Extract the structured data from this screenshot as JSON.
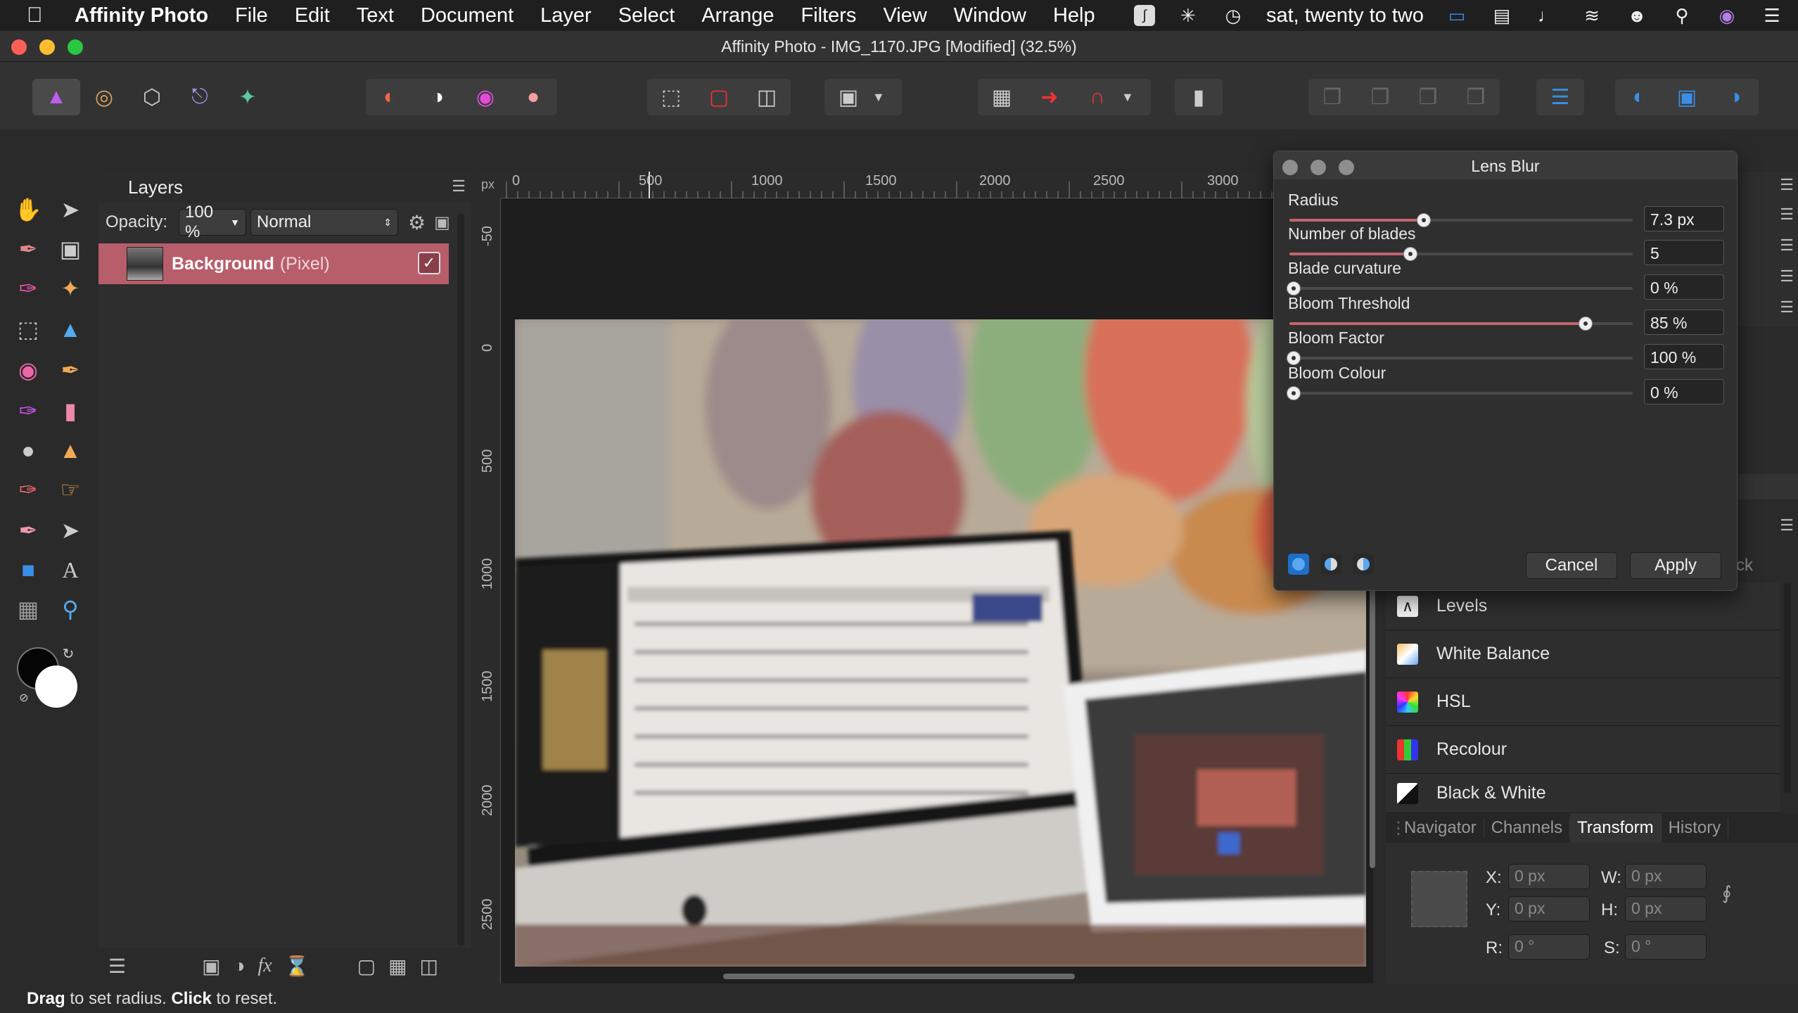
{
  "menubar": {
    "app_name": "Affinity Photo",
    "items": [
      "File",
      "Edit",
      "Text",
      "Document",
      "Layer",
      "Select",
      "Arrange",
      "Filters",
      "View",
      "Window",
      "Help"
    ],
    "clock": "sat, twenty to two"
  },
  "window": {
    "title": "Affinity Photo - IMG_1170.JPG [Modified] (32.5%)"
  },
  "layers_panel": {
    "tab": "Layers",
    "opacity_label": "Opacity:",
    "opacity_value": "100 %",
    "blend_mode": "Normal",
    "layer": {
      "name": "Background",
      "type": "(Pixel)",
      "visible_check": "✓"
    }
  },
  "ruler": {
    "unit": "px",
    "h_ticks": [
      "0",
      "500",
      "1000",
      "1500",
      "2000",
      "2500",
      "3000"
    ],
    "v_ticks": [
      "-50",
      "0",
      "500",
      "1000",
      "1500",
      "2000",
      "2500"
    ]
  },
  "lens_blur": {
    "title": "Lens Blur",
    "params": [
      {
        "label": "Radius",
        "value": "7.3 px",
        "level": 0.38
      },
      {
        "label": "Number of blades",
        "value": "5",
        "level": 0.34
      },
      {
        "label": "Blade curvature",
        "value": "0 %",
        "level": 0
      },
      {
        "label": "Bloom Threshold",
        "value": "85 %",
        "level": 0.85
      },
      {
        "label": "Bloom Factor",
        "value": "100 %",
        "level": 0
      },
      {
        "label": "Bloom Colour",
        "value": "0 %",
        "level": 0
      }
    ],
    "cancel_label": "Cancel",
    "apply_label": "Apply"
  },
  "adjustments": {
    "items": [
      {
        "label": "Levels",
        "icon": "levels-icon"
      },
      {
        "label": "White Balance",
        "icon": "white-balance-icon"
      },
      {
        "label": "HSL",
        "icon": "hsl-icon"
      },
      {
        "label": "Recolour",
        "icon": "recolour-icon"
      },
      {
        "label": "Black & White",
        "icon": "black-white-icon"
      }
    ],
    "partial_text": "ck"
  },
  "bottom_panel": {
    "tabs": [
      "Navigator",
      "Channels",
      "Transform",
      "History"
    ],
    "active_tab": "Transform",
    "x_label": "X:",
    "x_value": "0 px",
    "y_label": "Y:",
    "y_value": "0 px",
    "w_label": "W:",
    "w_value": "0 px",
    "h_label": "H:",
    "h_value": "0 px",
    "r_label": "R:",
    "r_value": "0 °",
    "s_label": "S:",
    "s_value": "0 °"
  },
  "statusbar": {
    "drag_word": "Drag",
    "drag_text": " to set radius. ",
    "click_word": "Click",
    "click_text": " to reset."
  },
  "colors": {
    "accent": "#c16571",
    "selected_layer": "#b85d6a",
    "dialog_mode_blue": "#1f6fc8"
  }
}
